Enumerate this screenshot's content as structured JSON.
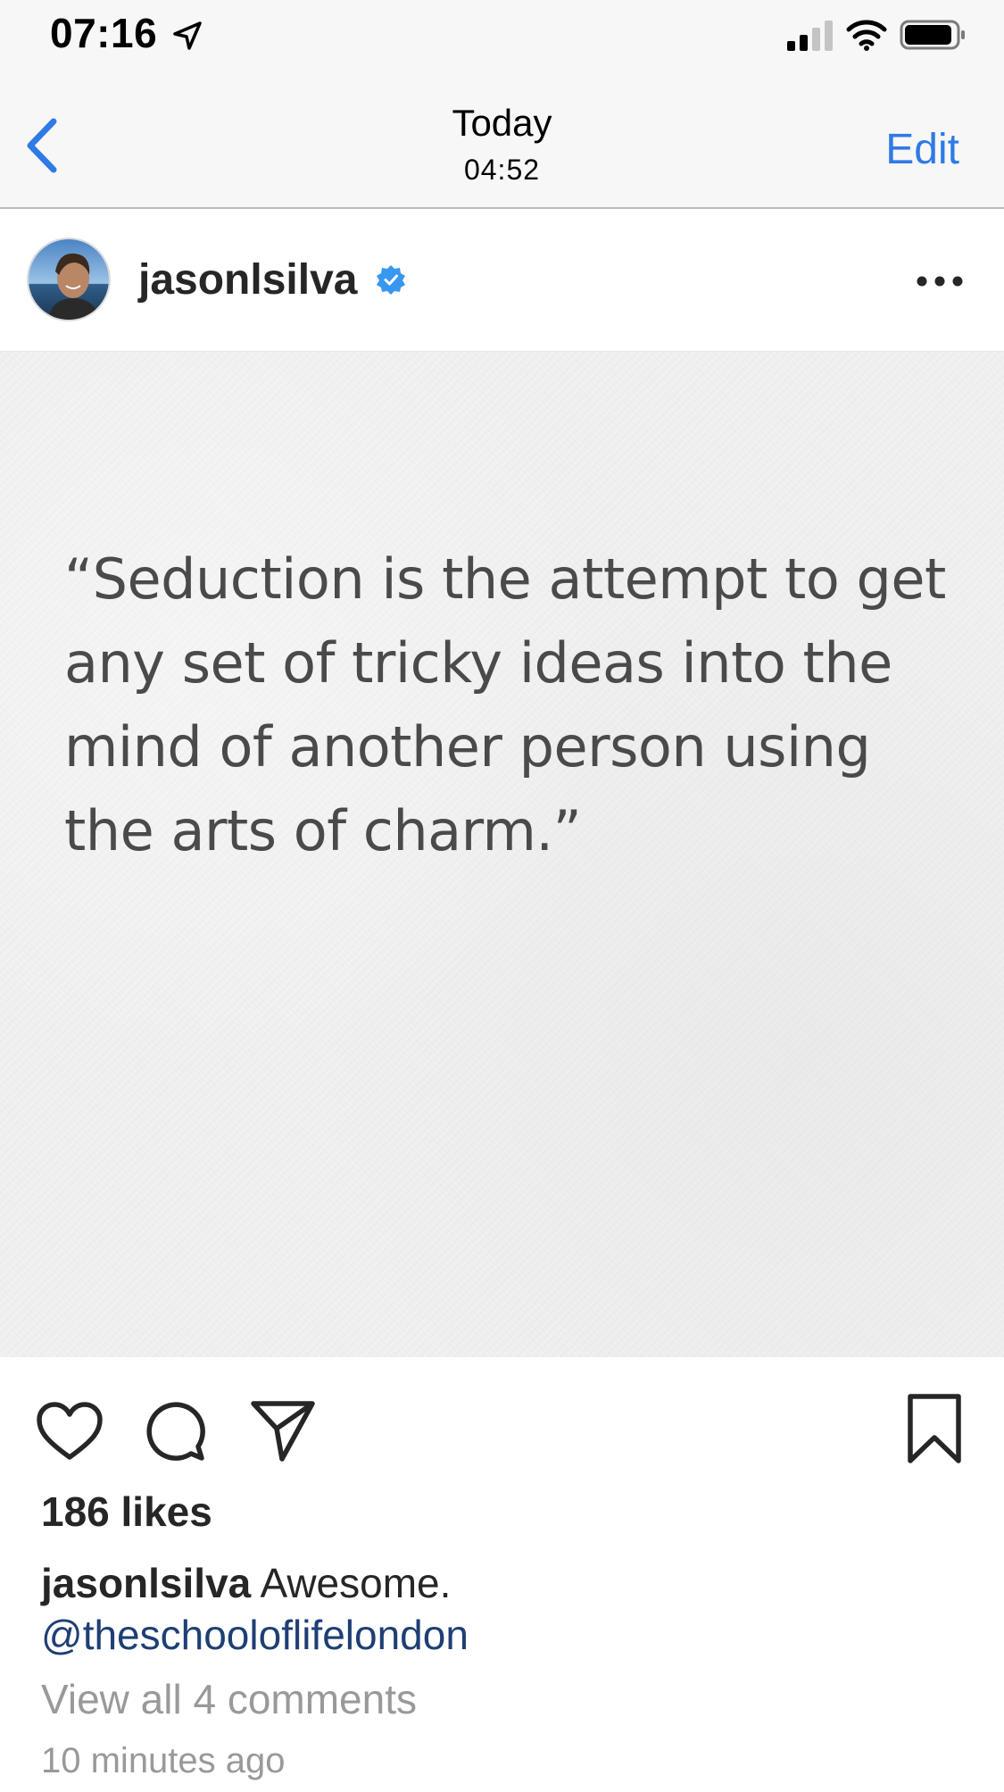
{
  "status_bar": {
    "time": "07:16",
    "icons": [
      "location-arrow-icon",
      "cellular-signal-icon",
      "wifi-icon",
      "battery-icon"
    ]
  },
  "nav": {
    "title": "Today",
    "subtitle": "04:52",
    "edit_label": "Edit",
    "back_icon": "chevron-left-icon",
    "accent_color": "#2f7ae5"
  },
  "post": {
    "username": "jasonlsilva",
    "verified": true,
    "verified_color": "#3897f0",
    "more_icon": "ellipsis-icon",
    "quote": "“Seduction is the attempt to get any set of tricky ideas into the mind of another person using the arts of charm.”",
    "actions": [
      "heart-icon",
      "comment-bubble-icon",
      "paper-plane-icon",
      "bookmark-icon"
    ],
    "likes": "186 likes",
    "caption_username": "jasonlsilva",
    "caption_text": "Awesome.",
    "caption_mention": "@theschooloflifelondon",
    "mention_color": "#1e3f74",
    "view_comments": "View all 4 comments",
    "timestamp": "10 minutes ago"
  }
}
